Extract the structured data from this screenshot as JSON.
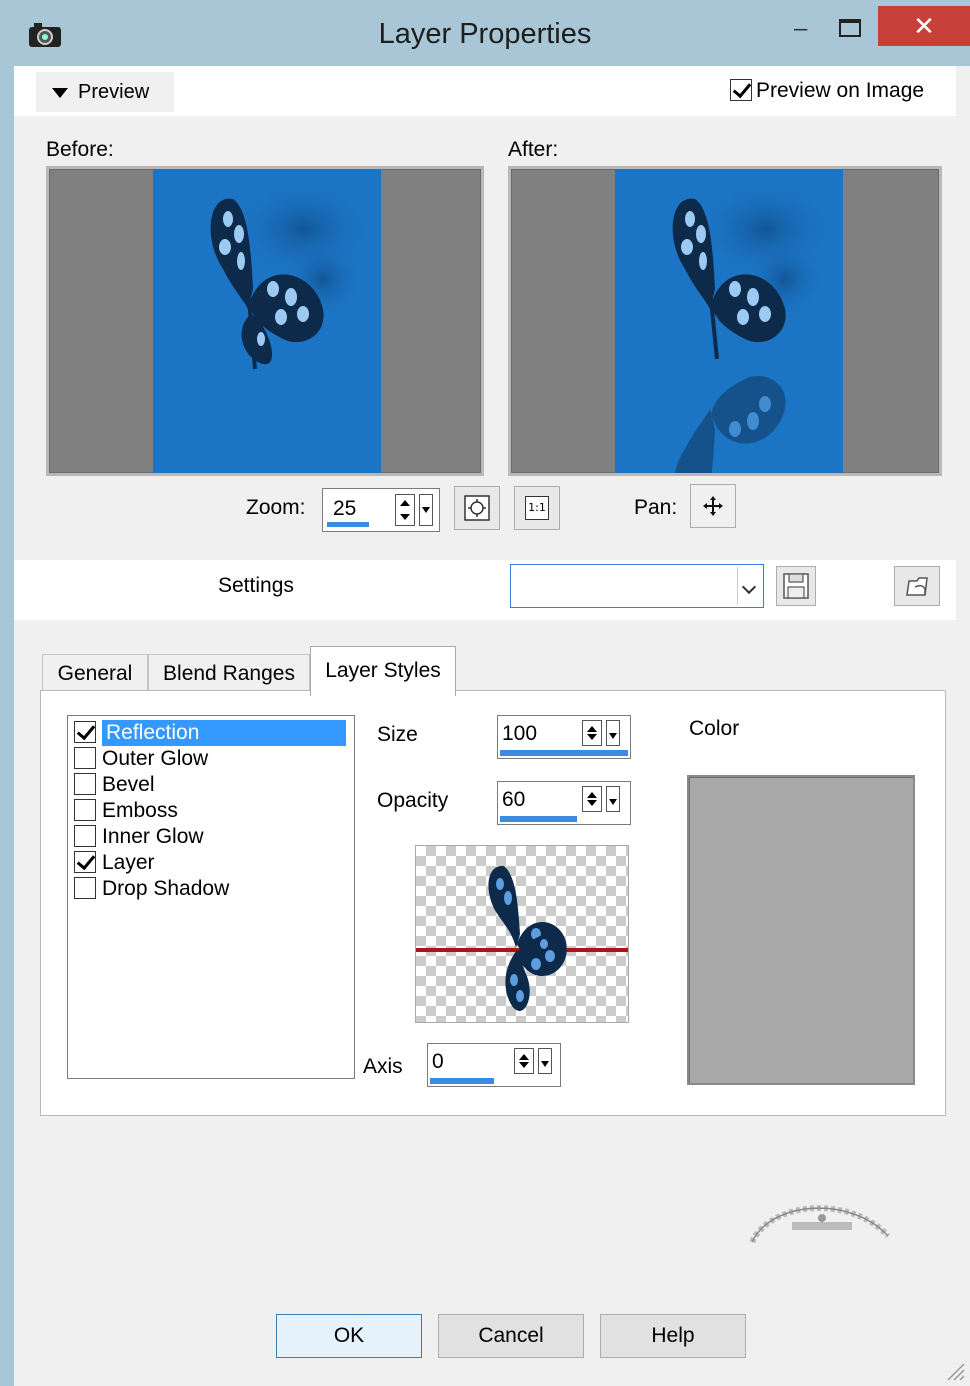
{
  "window": {
    "title": "Layer Properties",
    "minimize_glyph": "–",
    "close_glyph": "✕"
  },
  "preview": {
    "toggle_label": "Preview",
    "preview_on_image_label": "Preview on Image",
    "preview_on_image_checked": true,
    "before_label": "Before:",
    "after_label": "After:",
    "zoom_label": "Zoom:",
    "zoom_value": "25",
    "pan_label": "Pan:",
    "actual_size_label": "1:1"
  },
  "settings": {
    "label": "Settings",
    "selected_value": ""
  },
  "tabs": [
    {
      "label": "General",
      "active": false
    },
    {
      "label": "Blend Ranges",
      "active": false
    },
    {
      "label": "Layer Styles",
      "active": true
    }
  ],
  "layer_styles": {
    "items": [
      {
        "label": "Reflection",
        "checked": true,
        "selected": true
      },
      {
        "label": "Outer Glow",
        "checked": false,
        "selected": false
      },
      {
        "label": "Bevel",
        "checked": false,
        "selected": false
      },
      {
        "label": "Emboss",
        "checked": false,
        "selected": false
      },
      {
        "label": "Inner Glow",
        "checked": false,
        "selected": false
      },
      {
        "label": "Layer",
        "checked": true,
        "selected": false
      },
      {
        "label": "Drop Shadow",
        "checked": false,
        "selected": false
      }
    ],
    "size_label": "Size",
    "size_value": "100",
    "size_fraction": 1.0,
    "opacity_label": "Opacity",
    "opacity_value": "60",
    "opacity_fraction": 0.6,
    "axis_label": "Axis",
    "axis_value": "0",
    "axis_fraction": 0.5,
    "color_label": "Color",
    "color_value": "#a8a8a8"
  },
  "buttons": {
    "ok": "OK",
    "cancel": "Cancel",
    "help": "Help"
  },
  "colors": {
    "image_blue": "#1c74c4",
    "selection_blue": "#3399ff",
    "close_red": "#c7403a",
    "title_bar": "#a8c6d6"
  }
}
